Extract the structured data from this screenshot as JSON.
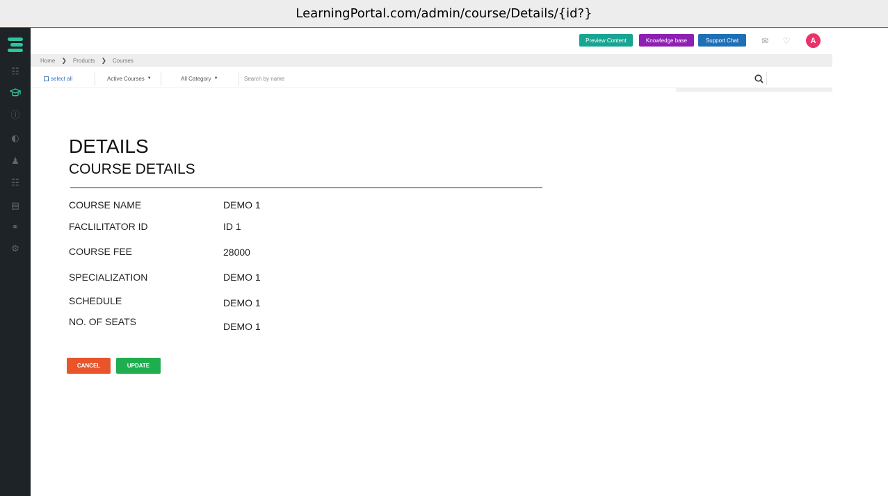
{
  "browser": {
    "url": "LearningPortal.com/admin/course/Details/{id?}"
  },
  "sidebar": {
    "icons": [
      "logo-icon",
      "dashboard-icon",
      "graduation-cap-icon",
      "help-icon",
      "chart-icon",
      "user-icon",
      "hierarchy-icon",
      "clipboard-icon",
      "globe-icon",
      "settings-icon"
    ],
    "accent_color": "#2ec4a0"
  },
  "header": {
    "preview_content": "Preview Content",
    "knowledge_base": "Knowledge base",
    "support_chat": "Support Chat",
    "avatar_letter": "A",
    "colors": {
      "preview": "#17a591",
      "knowledge": "#8e1fb3",
      "support": "#1f6fb5",
      "avatar": "#e8336b"
    }
  },
  "breadcrumb": {
    "home": "Home",
    "products": "Products",
    "courses": "Courses"
  },
  "filters": {
    "select_all": "select all",
    "active_courses": "Active Courses",
    "all_category": "All Category",
    "search_placeholder": "Search by name"
  },
  "page": {
    "title": "DETAILS",
    "subtitle": "COURSE DETAILS",
    "fields": [
      {
        "label": "COURSE NAME",
        "value": "DEMO 1"
      },
      {
        "label": "FACLILITATOR ID",
        "value": "ID 1"
      },
      {
        "label": "COURSE FEE",
        "value": "28000"
      },
      {
        "label": "SPECIALIZATION",
        "value": "DEMO 1"
      },
      {
        "label": "SCHEDULE",
        "value": "DEMO 1"
      },
      {
        "label": "NO. OF SEATS",
        "value": "DEMO 1"
      }
    ]
  },
  "actions": {
    "cancel": "CANCEL",
    "update": "UPDATE",
    "colors": {
      "cancel": "#e8552b",
      "update": "#1fae4f"
    }
  }
}
